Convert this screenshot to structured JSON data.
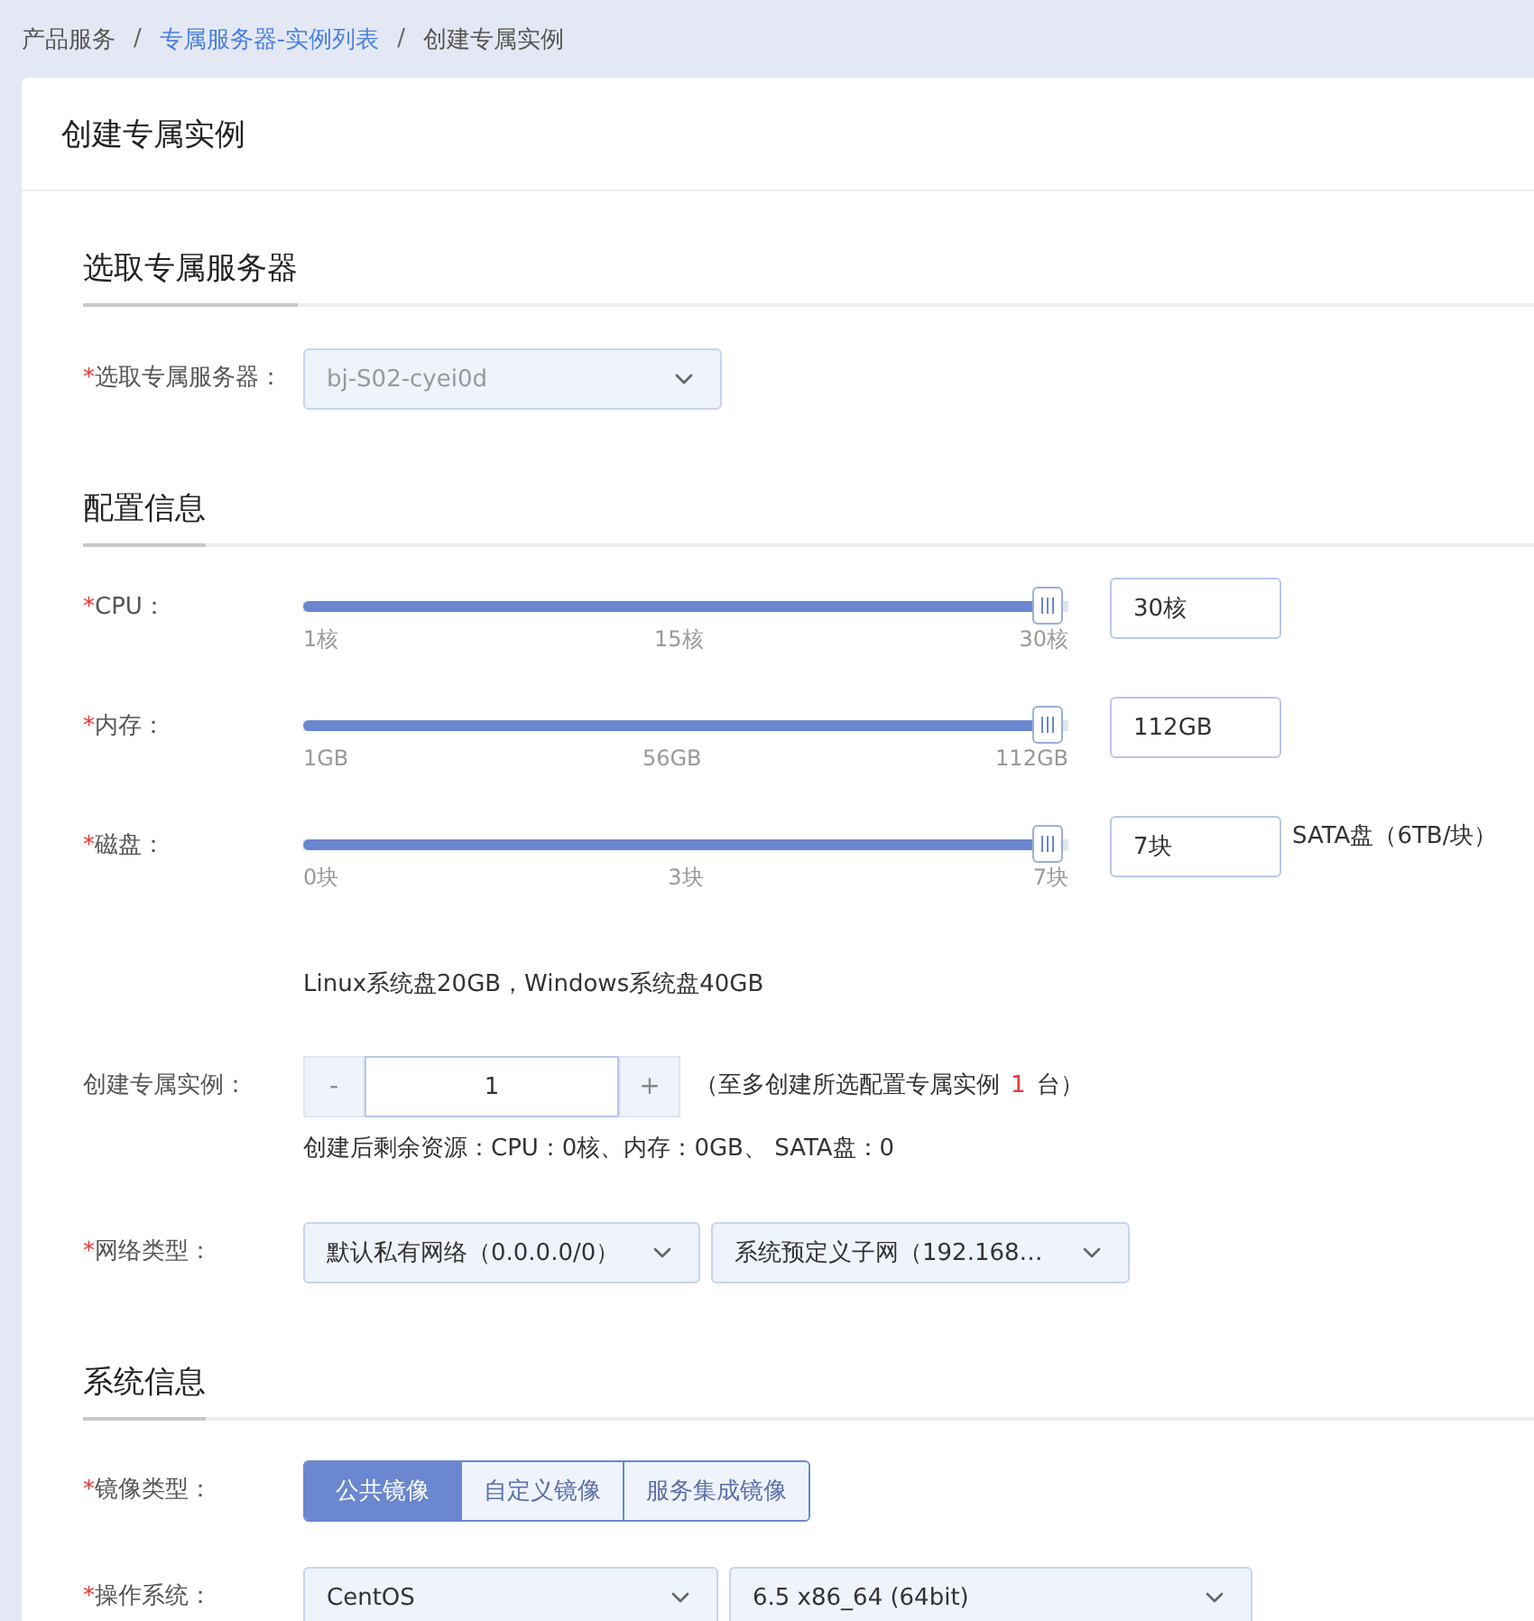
{
  "breadcrumb": [
    {
      "label": "产品服务",
      "link": false
    },
    {
      "separator": "/",
      "label": "专属服务器-实例列表",
      "link": true
    },
    {
      "separator": "/",
      "label": "创建专属实例",
      "link": false
    }
  ],
  "page_title": "创建专属实例",
  "server_section": {
    "title": "选取专属服务器",
    "server": {
      "label": "选取专属服务器：",
      "required_mark": "*",
      "value": "bj-S02-cyei0d",
      "disabled": true
    }
  },
  "config_section": {
    "title": "配置信息",
    "sliders": [
      {
        "label": "CPU：",
        "required_mark": "*",
        "level": 1,
        "ticks": [
          "1核",
          "15核",
          "30核"
        ],
        "value": "30核"
      },
      {
        "label": "内存：",
        "required_mark": "*",
        "level": 1,
        "ticks": [
          "1GB",
          "56GB",
          "112GB"
        ],
        "value": "112GB"
      },
      {
        "label": "磁盘：",
        "required_mark": "*",
        "level": 1,
        "ticks": [
          "0块",
          "3块",
          "7块"
        ],
        "value": "7块",
        "unit_note": "SATA盘（6TB/块）"
      }
    ],
    "system_disk_note": "Linux系统盘20GB，Windows系统盘40GB",
    "instance_count": {
      "label": "创建专属实例：",
      "minus": "-",
      "value": "1",
      "plus": "+",
      "hint_prefix": "（至多创建所选配置专属实例",
      "hint_count": "1",
      "hint_suffix": "台）",
      "remaining": "创建后剩余资源：CPU：0核、内存：0GB、 SATA盘：0"
    },
    "network": {
      "label": "网络类型：",
      "required_mark": "*",
      "selects": [
        "默认私有网络（0.0.0.0/0）",
        "系统预定义子网（192.168…"
      ]
    }
  },
  "system_section": {
    "title": "系统信息",
    "image_type": {
      "label": "镜像类型：",
      "required_mark": "*",
      "options": [
        {
          "label": "公共镜像",
          "selected": true
        },
        {
          "label": "自定义镜像",
          "selected": false
        },
        {
          "label": "服务集成镜像",
          "selected": false
        }
      ]
    },
    "os": {
      "label": "操作系统：",
      "required_mark": "*",
      "selects": [
        "CentOS",
        "6.5 x86_64 (64bit)"
      ]
    }
  }
}
